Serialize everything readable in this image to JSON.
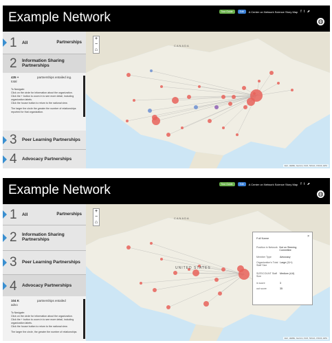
{
  "app": {
    "title": "Example Network",
    "badge": "Tour Guide",
    "button": "Edit",
    "tagline": "A Center on Network Science Story Map",
    "social": "f t ⬈"
  },
  "panel1": {
    "sections": [
      {
        "number": "1",
        "label": "All",
        "right": "Partnerships"
      },
      {
        "number": "2",
        "label": "Information Sharing Partnerships"
      },
      {
        "number": "3",
        "label": "Peer Learning Partnerships"
      },
      {
        "number": "4",
        "label": "Advocacy Partnerships"
      }
    ],
    "stat_value": "435 +",
    "stat_unit": "total",
    "stat_label": "partnerships entailed ing.",
    "navigate_title": "To Navigate:",
    "navigate_lines": [
      "Click on the circle for information about the organization.",
      "Click the + button to zoom in to see more detail, including",
      "organization labels.",
      "Click the house button to return to the national view.",
      "The larger the circle the greater the number of relationships",
      "reported for that organization."
    ]
  },
  "panel2": {
    "sections": [
      {
        "number": "1",
        "label": "All",
        "right": "Partnerships"
      },
      {
        "number": "2",
        "label": "Information Sharing Partnerships"
      },
      {
        "number": "3",
        "label": "Peer Learning Partnerships"
      },
      {
        "number": "4",
        "label": "Advocacy Partnerships"
      }
    ],
    "stat_value": "104 K",
    "stat_unit": "advo",
    "stat_label": "partnerships entailed",
    "navigate_title": "To Navigate:",
    "navigate_lines": [
      "Click on the circle for information about the organization.",
      "Click the + button to zoom in to see more detail, including",
      "organization labels.",
      "Click the house button to return to the national view.",
      "The larger the circle, the greater the number of relationships"
    ]
  },
  "map": {
    "country_label": "CANADA",
    "state_label": "UNITED STATES",
    "attribution": "Esri, HERE, Garmin, FAO, NOAA, USGS, EPA",
    "zoom_in": "+",
    "zoom_out": "−",
    "home": "⌂"
  },
  "popup": {
    "title": "Full Name",
    "close": "×",
    "rows": [
      {
        "k": "Position in Network",
        "v": "Not on Steering Committee"
      },
      {
        "k": "Member Type",
        "v": "Advocacy"
      },
      {
        "k": "Organization's Total Staff Size",
        "v": "Large (11+)"
      },
      {
        "k": "SIZE/COUNT Staff Size",
        "v": "Medium (4-6)"
      },
      {
        "k": "in score",
        "v": "3"
      },
      {
        "k": "out score",
        "v": "35"
      }
    ]
  },
  "colors": {
    "accent": "#3a8fd0",
    "node_red": "#e8625a",
    "node_blue": "#6c8fd1",
    "node_purple": "#8e5fb5",
    "badge_green": "#6ab04c"
  }
}
